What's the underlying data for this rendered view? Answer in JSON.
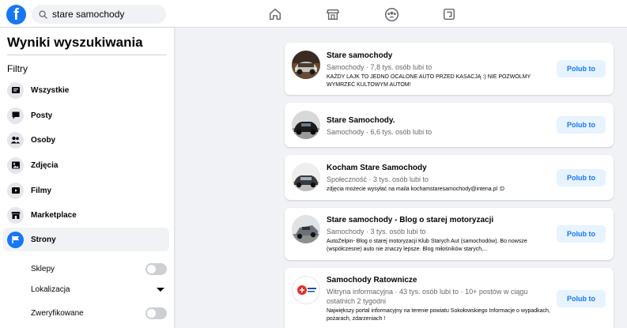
{
  "app": {
    "brand_letter": "f",
    "brand_color": "#1877f2"
  },
  "search": {
    "value": "stare samochody"
  },
  "top_nav": {
    "icons": [
      "home-icon",
      "marketplace-icon",
      "groups-icon",
      "gaming-icon"
    ]
  },
  "sidebar": {
    "title": "Wyniki wyszukiwania",
    "filters_label": "Filtry",
    "items": [
      {
        "label": "Wszystkie",
        "icon": "all-results-icon"
      },
      {
        "label": "Posty",
        "icon": "posts-icon"
      },
      {
        "label": "Osoby",
        "icon": "people-icon"
      },
      {
        "label": "Zdjęcia",
        "icon": "photos-icon"
      },
      {
        "label": "Filmy",
        "icon": "videos-icon"
      },
      {
        "label": "Marketplace",
        "icon": "marketplace-icon"
      },
      {
        "label": "Strony",
        "icon": "pages-flag-icon",
        "active": true
      }
    ],
    "subfilters": {
      "shops": "Sklepy",
      "location": "Lokalizacja",
      "verified": "Zweryfikowane"
    }
  },
  "results": [
    {
      "title": "Stare samochody",
      "meta": "Samochody · 7,8 tys. osób lubi to",
      "desc": "KAŻDY LAJK TO JEDNO OCALONE AUTO PRZED KASACJĄ :) NIE POZWÓLMY WYMRZEĆ KULTOWYM AUTOM!",
      "button": "Polub to"
    },
    {
      "title": "Stare Samochody.",
      "meta": "Samochody · 6,6 tys. osób lubi to",
      "desc": "",
      "button": "Polub to"
    },
    {
      "title": "Kocham Stare Samochody",
      "meta": "Społeczność · 3 tys. osób lubi to",
      "desc": "zdjęcia możecie wysyłać na maila kochamstaresamochody@intena.pl :D",
      "button": "Polub to"
    },
    {
      "title": "Stare samochody - Blog o starej motoryzacji",
      "meta": "Samochody · 3 tys. osób lubi to",
      "desc": "AutoZelpin- Blog o starej motoryzacji Klub Starych Aut (samochodów). Bo nowsze (współczesne) auto nie znaczy lepsze. Blog miłośników starych,...",
      "button": "Polub to"
    },
    {
      "title": "Samochody Ratownicze",
      "meta": "Witryna informacyjna · 43 tys. osób lubi to · 10+ postów w ciągu ostatnich 2 tygodni",
      "desc": "Największy portal informacyjny na terenie powiatu Sokołowskiego Informacje o wypadkach, pożarach, zdarzeniach !",
      "button": "Polub to"
    }
  ]
}
